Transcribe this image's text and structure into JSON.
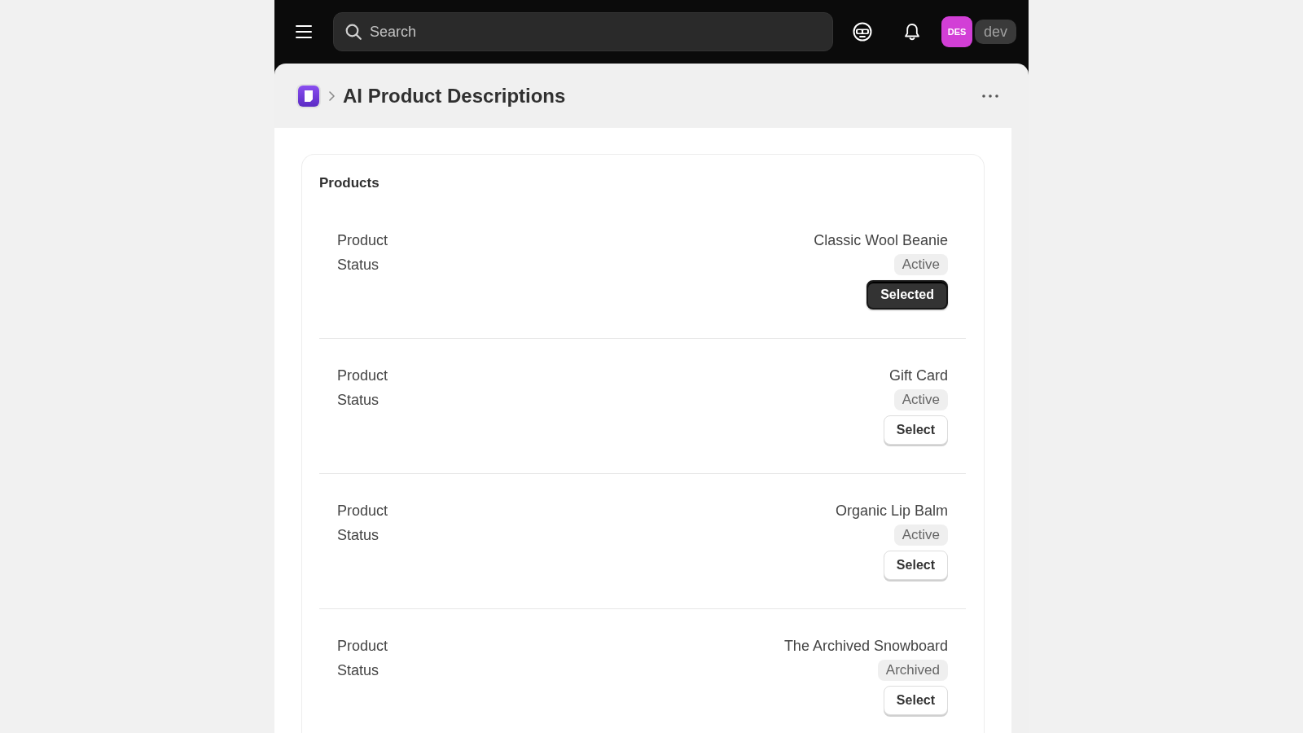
{
  "top_bar": {
    "search": {
      "placeholder": "Search"
    },
    "avatar": {
      "initials": "DES"
    },
    "account": "dev"
  },
  "page": {
    "title": "AI Product Descriptions"
  },
  "card": {
    "title": "Products",
    "items": [
      {
        "product_label": "Product",
        "status_label": "Status",
        "name": "Classic Wool Beanie",
        "status": "Active",
        "button": "Selected",
        "selected": true
      },
      {
        "product_label": "Product",
        "status_label": "Status",
        "name": "Gift Card",
        "status": "Active",
        "button": "Select",
        "selected": false
      },
      {
        "product_label": "Product",
        "status_label": "Status",
        "name": "Organic Lip Balm",
        "status": "Active",
        "button": "Select",
        "selected": false
      },
      {
        "product_label": "Product",
        "status_label": "Status",
        "name": "The Archived Snowboard",
        "status": "Archived",
        "button": "Select",
        "selected": false
      }
    ]
  }
}
